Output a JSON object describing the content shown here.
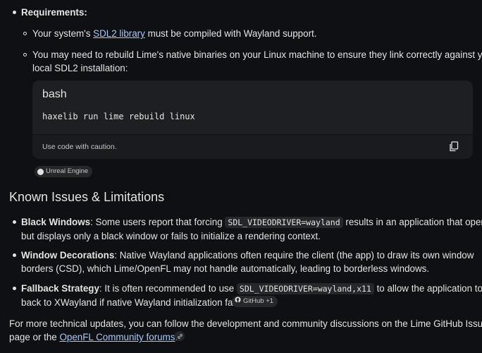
{
  "requirements": {
    "heading": "Requirements:",
    "item1": {
      "pre": "Your system's ",
      "link": "SDL2 library",
      "post": " must be compiled with Wayland support."
    },
    "item2_line1": "You may need to rebuild Lime's native binaries on your Linux machine to ensure they link correctly against your",
    "item2_line2": "local SDL2 installation:"
  },
  "code_block": {
    "language": "bash",
    "code": "haxelib run lime rebuild linux",
    "caution": "Use code with caution."
  },
  "source_chip_unreal": "Unreal Engine",
  "section_title": "Known Issues & Limitations",
  "issues": [
    {
      "title": "Black Windows",
      "line1_pre": ": Some users report that forcing ",
      "code": "SDL_VIDEODRIVER=wayland",
      "line1_post": " results in an application that opens",
      "line2": "but displays only a black window or fails to initialize a rendering context."
    },
    {
      "title": "Window Decorations",
      "line1": ": Native Wayland applications often require the client (the app) to draw its own window",
      "line2": "borders (CSD), which Lime/OpenFL may not handle automatically, leading to borderless windows."
    },
    {
      "title": "Fallback Strategy",
      "line1_pre": ": It is often recommended to use ",
      "code": "SDL_VIDEODRIVER=wayland,x11",
      "line1_post": " to allow the application to fall",
      "line2": "back to XWayland if native Wayland initialization fails.",
      "chip": "GitHub +1"
    }
  ],
  "footer": {
    "line1": "For more technical updates, you can follow the development and community discussions on the Lime GitHub Issues",
    "line2_pre": "page or the ",
    "link": "OpenFL Community forums",
    "line2_post": "."
  },
  "icons": {
    "copy": "copy-icon",
    "link": "link-icon",
    "github": "github-icon"
  }
}
